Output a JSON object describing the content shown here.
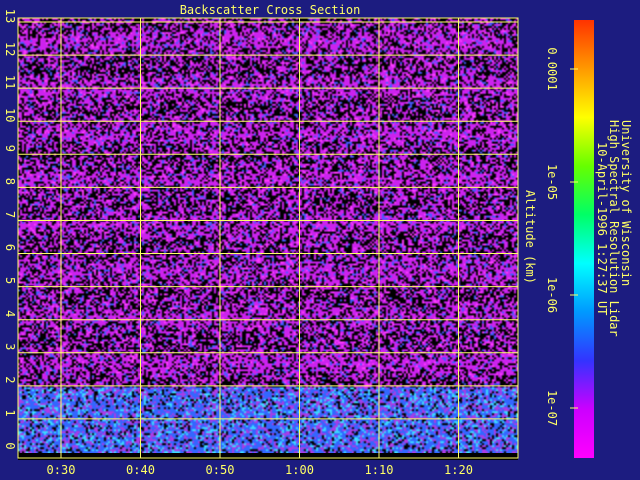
{
  "chart_data": {
    "type": "heatmap",
    "title": "Backscatter Cross Section",
    "ylabel": "Altitude (km)",
    "xlabel": "",
    "x_ticks": [
      "0:30",
      "0:40",
      "0:50",
      "1:00",
      "1:10",
      "1:20"
    ],
    "y_ticks": [
      "0",
      "1",
      "2",
      "3",
      "4",
      "5",
      "6",
      "7",
      "8",
      "9",
      "10",
      "11",
      "12",
      "13"
    ],
    "ylim": [
      0,
      13
    ],
    "grid": true,
    "colorbar": {
      "scale": "log",
      "ticks": [
        "1e-07",
        "1e-06",
        "1e-05",
        "0.0001"
      ],
      "colors": [
        "#ff00ff",
        "#cc00ff",
        "#3333ff",
        "#0099ff",
        "#00ffff",
        "#00ff66",
        "#66ff00",
        "#ffff00",
        "#ff9900",
        "#ff3300"
      ]
    },
    "annotation": {
      "line1": "University of Wisconsin",
      "line2": "High Spectral Resolution Lidar",
      "line3": "10-April-1996  1:27:37 UT"
    },
    "colors": {
      "background": "#1c1c80",
      "grid": "#ffff66",
      "text": "#ffff66",
      "low_band": "#3366ff",
      "high_band": "#cc22ee"
    }
  }
}
